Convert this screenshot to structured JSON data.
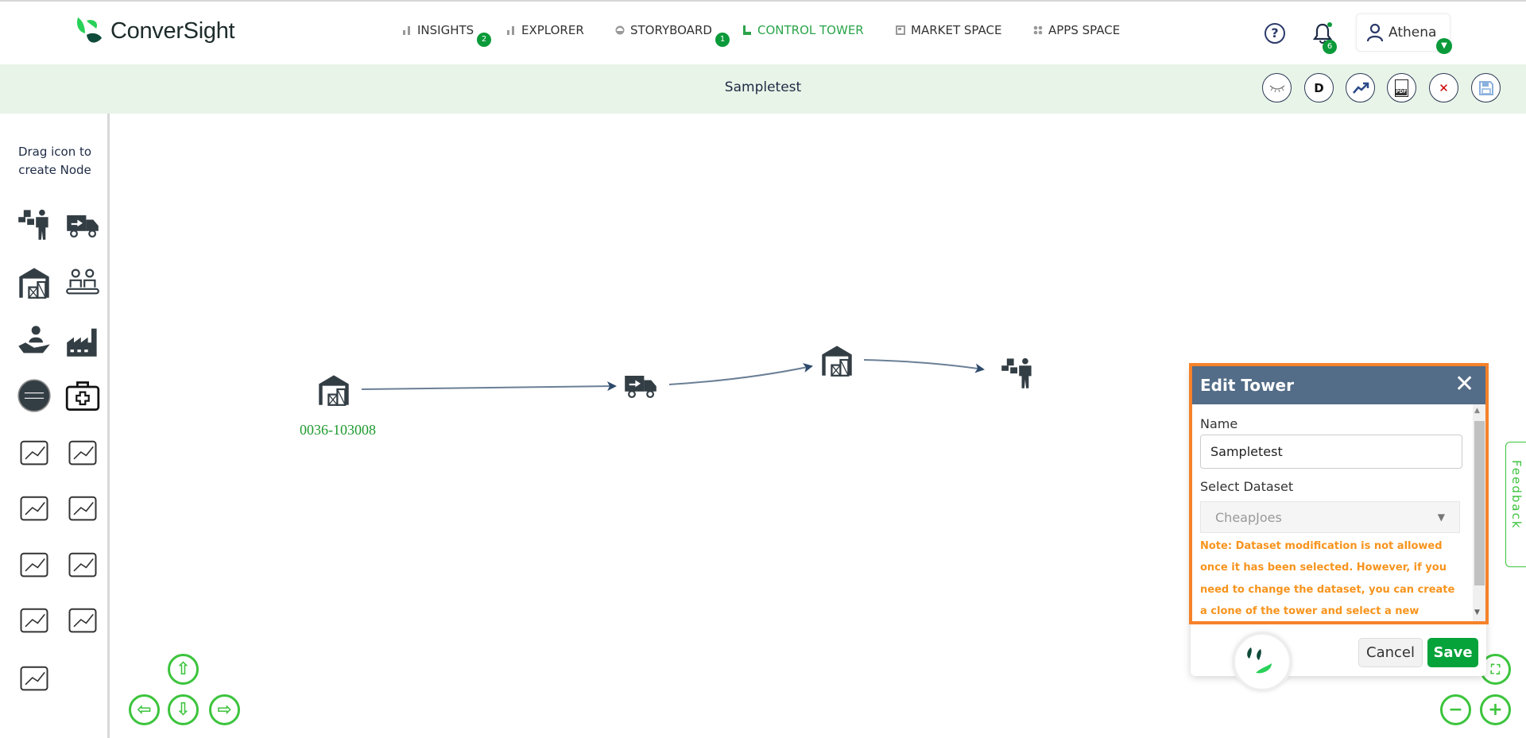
{
  "brand": {
    "name": "ConverSight",
    "accent": "#2aa44a"
  },
  "nav": [
    {
      "label": "INSIGHTS",
      "icon": "bar-chart-icon",
      "badge": "2"
    },
    {
      "label": "EXPLORER",
      "icon": "bar-chart-icon"
    },
    {
      "label": "STORYBOARD",
      "icon": "storyboard-icon",
      "badge": "1"
    },
    {
      "label": "CONTROL TOWER",
      "icon": "control-tower-icon",
      "active": true
    },
    {
      "label": "MARKET SPACE",
      "icon": "market-space-icon"
    },
    {
      "label": "APPS SPACE",
      "icon": "apps-grid-icon"
    }
  ],
  "header": {
    "help": "?",
    "notifications_count": "6",
    "user": "Athena"
  },
  "titlebar": {
    "title": "Sampletest",
    "toolbar": [
      "eye-closed",
      "D",
      "trend",
      "PDF",
      "close",
      "save"
    ],
    "d_label": "D"
  },
  "sidebar": {
    "instruction": "Drag icon to create Node",
    "icons": [
      "worker-boxes",
      "delivery-truck",
      "warehouse",
      "conveyor-workers",
      "hand-person",
      "factory",
      "dealer",
      "first-aid-kit",
      "analytics-growth",
      "package-location",
      "global-logistics",
      "distribution-center",
      "lab-equipment",
      "doctor",
      "discount-hand",
      "shopping-hand",
      "storage-facility"
    ]
  },
  "canvas": {
    "nodes": [
      {
        "type": "warehouse",
        "label": "0036-103008"
      },
      {
        "type": "delivery-truck"
      },
      {
        "type": "warehouse"
      },
      {
        "type": "worker-boxes"
      }
    ],
    "edge_color": "#2d4a6b"
  },
  "modal": {
    "title": "Edit Tower",
    "name_label": "Name",
    "name_value": "Sampletest",
    "dataset_label": "Select Dataset",
    "dataset_value": "CheapJoes",
    "note": "Note: Dataset modification is not allowed once it has been selected. However, if you need to change the dataset, you can create a clone of the tower and select a new dataset for the",
    "cancel": "Cancel",
    "save": "Save"
  },
  "feedback": "Feedback"
}
